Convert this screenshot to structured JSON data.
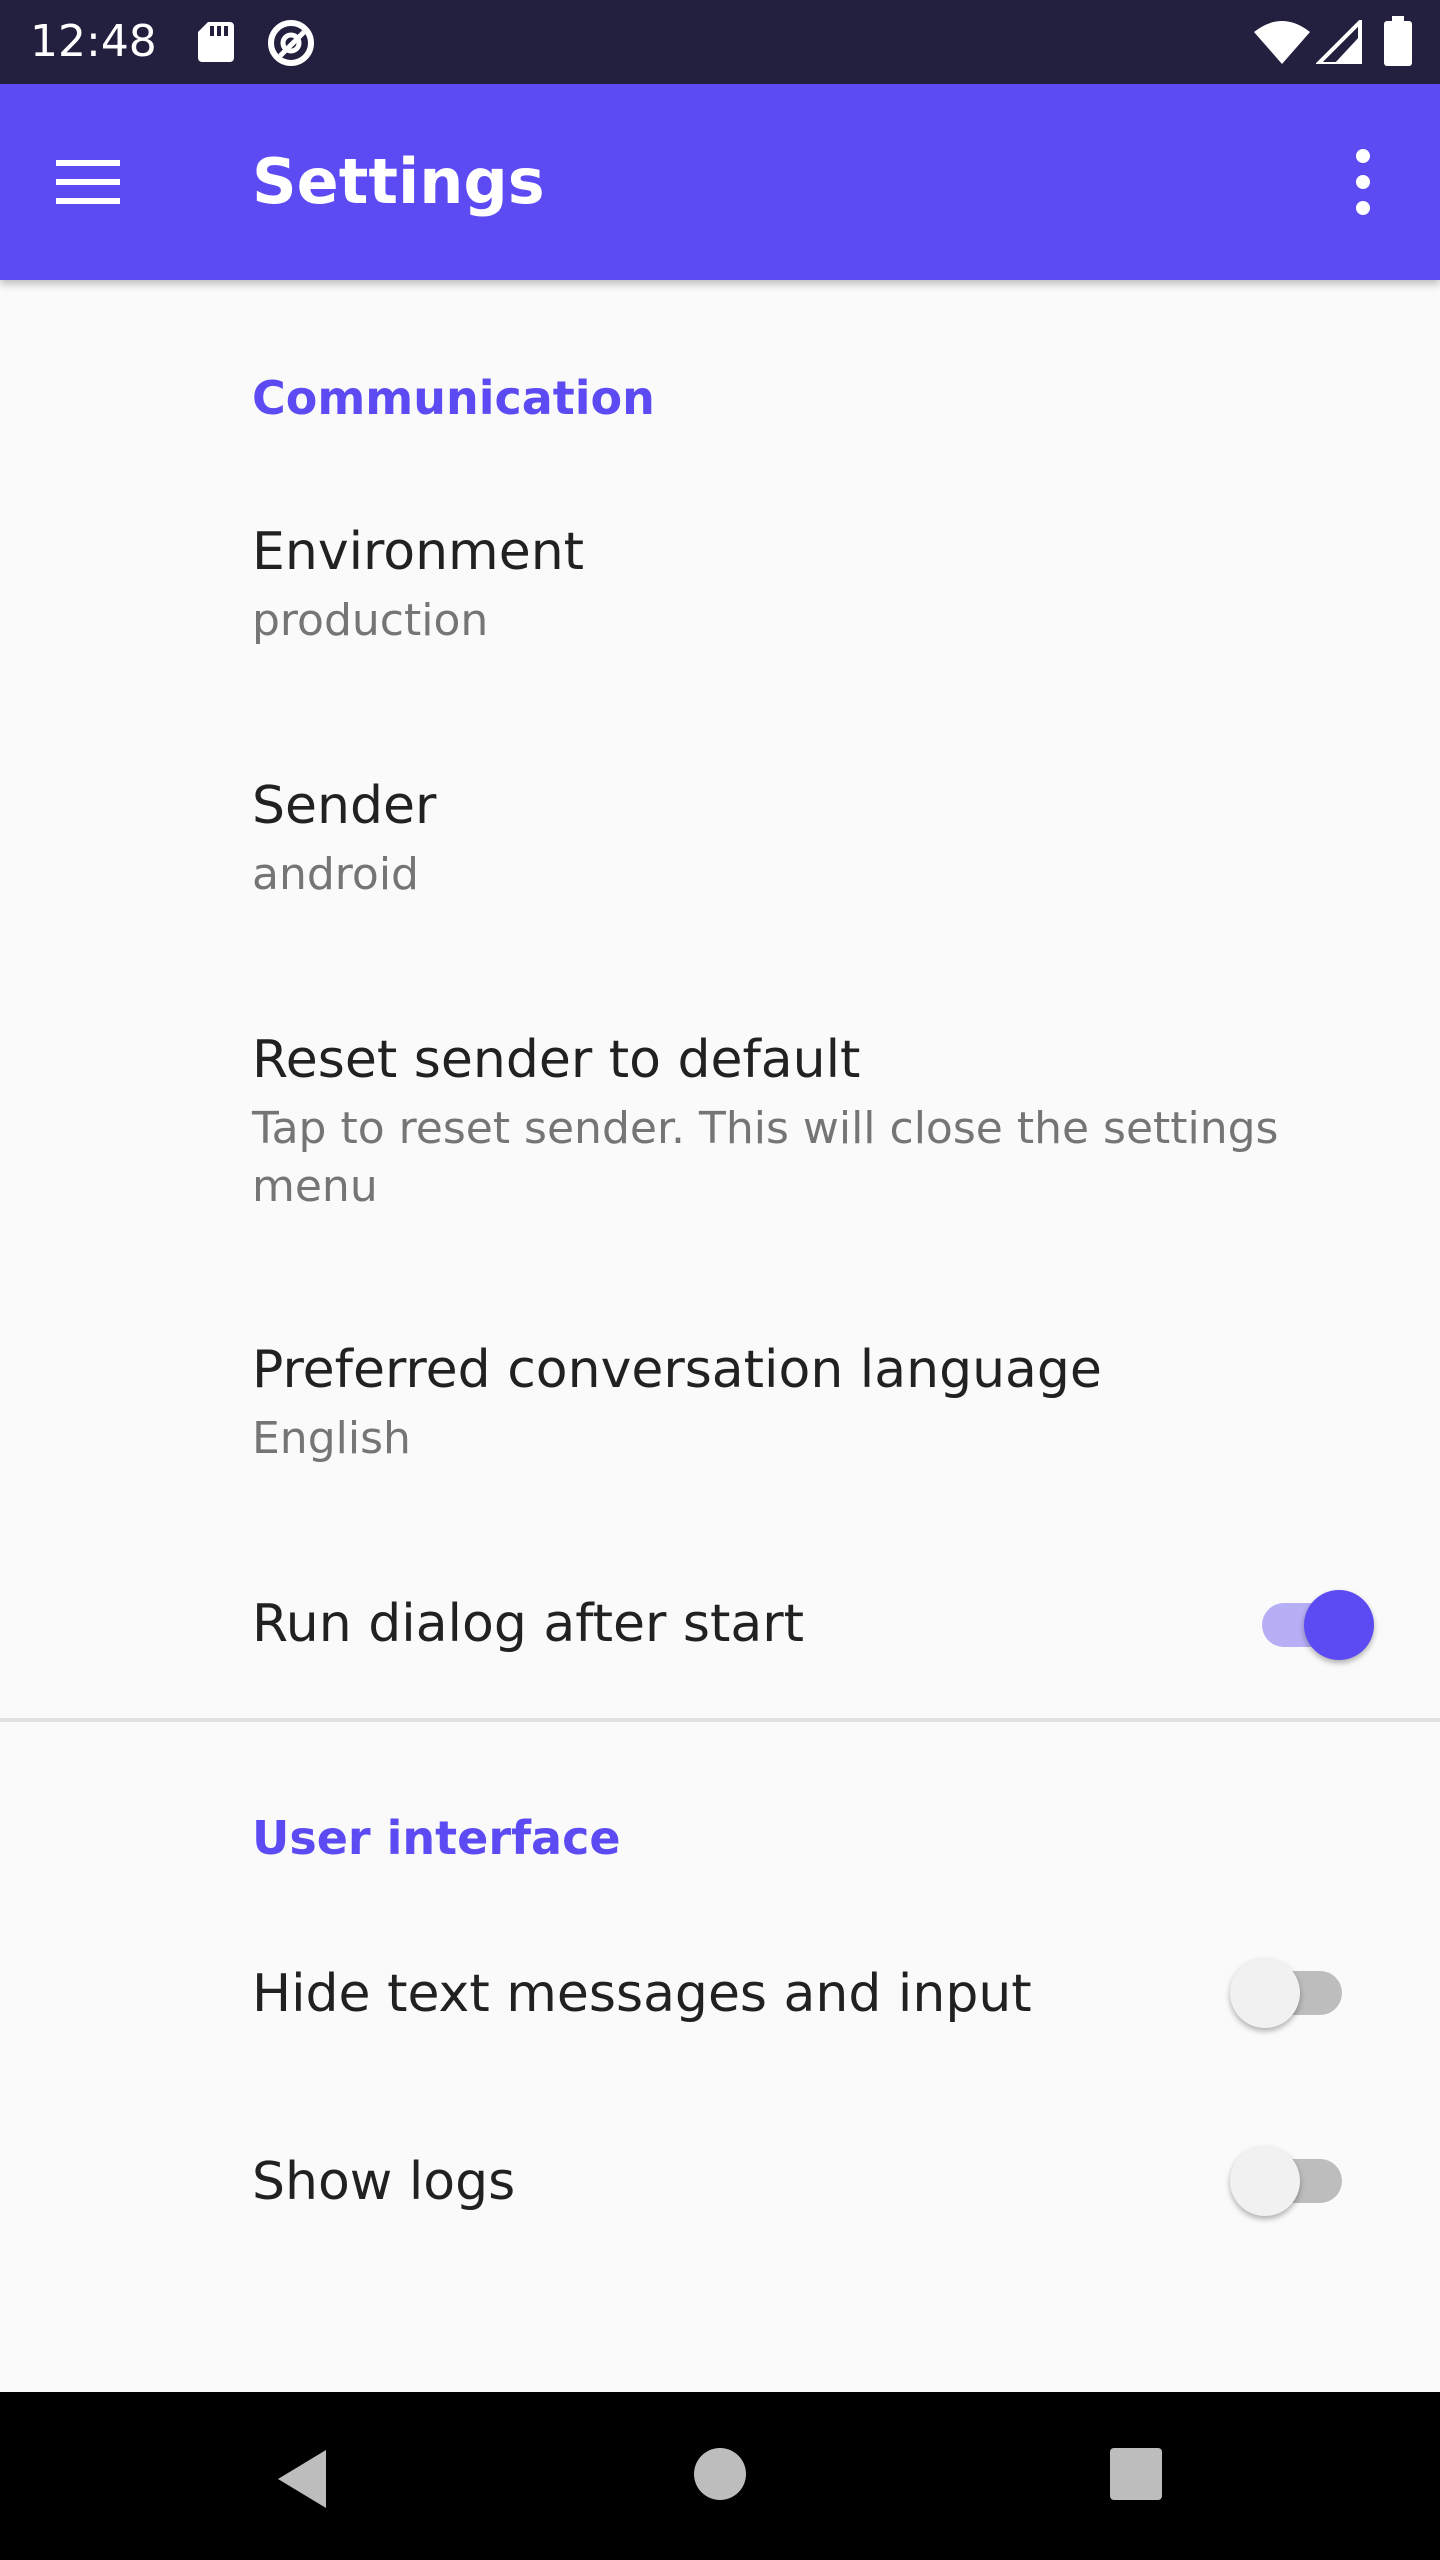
{
  "status_bar": {
    "time": "12:48",
    "icons": [
      "sd-card-icon",
      "at-sign-icon",
      "wifi-icon",
      "signal-icon",
      "battery-icon"
    ]
  },
  "app_bar": {
    "title": "Settings",
    "background": "#5c4bf2"
  },
  "sections": {
    "communication": {
      "header": "Communication",
      "environment": {
        "title": "Environment",
        "summary": "production"
      },
      "sender": {
        "title": "Sender",
        "summary": "android"
      },
      "reset_sender": {
        "title": "Reset sender to default",
        "summary": "Tap to reset sender. This will close the settings menu"
      },
      "language": {
        "title": "Preferred conversation language",
        "summary": "English"
      },
      "run_dialog": {
        "title": "Run dialog after start",
        "enabled": true
      }
    },
    "user_interface": {
      "header": "User interface",
      "hide_text": {
        "title": "Hide text messages and input",
        "enabled": false
      },
      "show_logs": {
        "title": "Show logs",
        "enabled": false
      }
    }
  },
  "colors": {
    "accent": "#5c4bf2",
    "status_bar": "#231f3f",
    "background": "#fafafa"
  }
}
